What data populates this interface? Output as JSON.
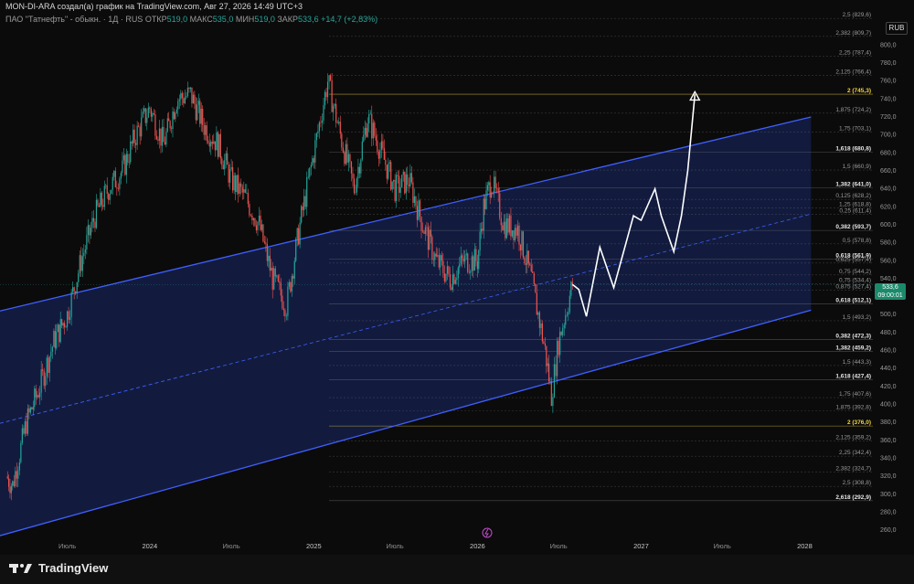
{
  "header": {
    "attribution": "MON-DI-ARA создал(а) график на TradingView.com, Авг 27, 2026 14:49 UTC+3",
    "symbol": "ПАО \"Татнефть\" - обыкн. · 1Д · RUS",
    "open_label": "ОТКР",
    "open_value": "519,0",
    "high_label": "МАКС",
    "high_value": "535,0",
    "low_label": "МИН",
    "low_value": "519,0",
    "close_label": "ЗАКР",
    "close_value": "533,6",
    "change": "+14,7 (+2,83%)"
  },
  "currency": "RUB",
  "price_tag": {
    "price": "533,6",
    "countdown": "09:00:01"
  },
  "brand": "TradingView",
  "colors": {
    "channel": "#3f5fff",
    "fill": "#1a2a6a",
    "up": "#26a69a",
    "down": "#ef5350",
    "projection": "#ffffff"
  },
  "chart_data": {
    "type": "candlestick",
    "y_axis": {
      "range": [
        250,
        840
      ],
      "ticks": [
        260,
        280,
        300,
        320,
        340,
        360,
        380,
        400,
        420,
        440,
        460,
        480,
        500,
        520,
        540,
        560,
        580,
        600,
        620,
        640,
        660,
        680,
        700,
        720,
        740,
        760,
        780,
        800
      ]
    },
    "x_axis": {
      "range": [
        "2023-02-01",
        "2028-06-01"
      ],
      "labels": [
        {
          "t": "2023-07-01",
          "text": "Июль"
        },
        {
          "t": "2024-01-01",
          "text": "2024"
        },
        {
          "t": "2024-07-01",
          "text": "Июль"
        },
        {
          "t": "2025-01-01",
          "text": "2025"
        },
        {
          "t": "2025-07-01",
          "text": "Июль"
        },
        {
          "t": "2026-01-01",
          "text": "2026"
        },
        {
          "t": "2026-07-01",
          "text": "Июль"
        },
        {
          "t": "2027-01-01",
          "text": "2027"
        },
        {
          "t": "2027-07-01",
          "text": "Июль"
        },
        {
          "t": "2028-01-01",
          "text": "2028"
        }
      ]
    },
    "price_path": [
      [
        "2023-02-15",
        320
      ],
      [
        "2023-03-01",
        310
      ],
      [
        "2023-04-01",
        380
      ],
      [
        "2023-05-01",
        420
      ],
      [
        "2023-06-01",
        470
      ],
      [
        "2023-07-01",
        500
      ],
      [
        "2023-08-01",
        560
      ],
      [
        "2023-09-01",
        610
      ],
      [
        "2023-10-01",
        640
      ],
      [
        "2023-11-01",
        660
      ],
      [
        "2023-12-01",
        700
      ],
      [
        "2024-01-01",
        730
      ],
      [
        "2024-02-01",
        690
      ],
      [
        "2024-03-01",
        740
      ],
      [
        "2024-04-01",
        745
      ],
      [
        "2024-05-01",
        710
      ],
      [
        "2024-06-01",
        690
      ],
      [
        "2024-07-01",
        650
      ],
      [
        "2024-08-01",
        630
      ],
      [
        "2024-09-01",
        600
      ],
      [
        "2024-10-01",
        540
      ],
      [
        "2024-11-01",
        510
      ],
      [
        "2024-12-01",
        600
      ],
      [
        "2025-01-01",
        680
      ],
      [
        "2025-02-01",
        760
      ],
      [
        "2025-03-01",
        700
      ],
      [
        "2025-04-01",
        640
      ],
      [
        "2025-05-01",
        720
      ],
      [
        "2025-06-01",
        680
      ],
      [
        "2025-07-01",
        640
      ],
      [
        "2025-08-01",
        650
      ],
      [
        "2025-09-01",
        600
      ],
      [
        "2025-10-01",
        560
      ],
      [
        "2025-11-01",
        540
      ],
      [
        "2025-12-01",
        560
      ],
      [
        "2026-01-01",
        560
      ],
      [
        "2026-01-15",
        620
      ],
      [
        "2026-02-01",
        650
      ],
      [
        "2026-03-01",
        600
      ],
      [
        "2026-04-01",
        595
      ],
      [
        "2026-05-01",
        540
      ],
      [
        "2026-06-01",
        460
      ],
      [
        "2026-06-15",
        410
      ],
      [
        "2026-07-01",
        470
      ],
      [
        "2026-08-01",
        533.6
      ]
    ],
    "projection": [
      [
        "2026-08-15",
        528
      ],
      [
        "2026-09-01",
        498
      ],
      [
        "2026-10-01",
        575
      ],
      [
        "2026-11-01",
        530
      ],
      [
        "2026-12-15",
        610
      ],
      [
        "2027-01-01",
        605
      ],
      [
        "2027-02-01",
        640
      ],
      [
        "2027-02-15",
        610
      ],
      [
        "2027-03-15",
        570
      ],
      [
        "2027-04-01",
        610
      ],
      [
        "2027-04-15",
        660
      ],
      [
        "2027-05-01",
        745
      ]
    ],
    "channel": {
      "upper": [
        [
          "2023-02-01",
          504
        ],
        [
          "2028-01-15",
          720
        ]
      ],
      "lower": [
        [
          "2023-02-01",
          254
        ],
        [
          "2028-01-15",
          505
        ]
      ],
      "mid": [
        [
          "2023-02-01",
          379
        ],
        [
          "2028-01-15",
          612
        ]
      ]
    },
    "fib_levels": [
      {
        "text": "2,5 (829,6)",
        "y": 829.6,
        "bold": false
      },
      {
        "text": "2,382 (809,7)",
        "y": 809.7,
        "bold": false
      },
      {
        "text": "2,25 (787,4)",
        "y": 787.4,
        "bold": false
      },
      {
        "text": "2,125 (766,4)",
        "y": 766.4,
        "bold": false
      },
      {
        "text": "2 (745,3)",
        "y": 745.3,
        "bold": true,
        "color": "#f5d442"
      },
      {
        "text": "1,875 (724,2)",
        "y": 724.2,
        "bold": false
      },
      {
        "text": "1,75 (703,1)",
        "y": 703.1,
        "bold": false
      },
      {
        "text": "1,618 (680,8)",
        "y": 680.8,
        "bold": true
      },
      {
        "text": "1,5 (660,9)",
        "y": 660.9,
        "bold": false
      },
      {
        "text": "1,382 (641,0)",
        "y": 641.0,
        "bold": true
      },
      {
        "text": "0,125 (628,2)",
        "y": 628.2,
        "bold": false
      },
      {
        "text": "1,25 (618,8)",
        "y": 618.8,
        "bold": false
      },
      {
        "text": "0,25 (611,4)",
        "y": 611.4,
        "bold": false
      },
      {
        "text": "0,382 (593,7)",
        "y": 593.7,
        "bold": true
      },
      {
        "text": "0,5 (578,8)",
        "y": 578.8,
        "bold": false
      },
      {
        "text": "0,618 (561,9)",
        "y": 561.9,
        "bold": true
      },
      {
        "text": "0,625 (557,4)",
        "y": 557.4,
        "bold": false
      },
      {
        "text": "0,75 (544,2)",
        "y": 544.2,
        "bold": false
      },
      {
        "text": "0,75 (534,4)",
        "y": 534.4,
        "bold": false
      },
      {
        "text": "0,875 (527,4)",
        "y": 527.4,
        "bold": false
      },
      {
        "text": "0,618 (512,1)",
        "y": 512.1,
        "bold": true
      },
      {
        "text": "1,5 (493,2)",
        "y": 493.2,
        "bold": false
      },
      {
        "text": "0,382 (472,3)",
        "y": 472.3,
        "bold": true
      },
      {
        "text": "1,382 (459,2)",
        "y": 459.2,
        "bold": true
      },
      {
        "text": "1,5 (443,3)",
        "y": 443.3,
        "bold": false
      },
      {
        "text": "1,618 (427,4)",
        "y": 427.4,
        "bold": true
      },
      {
        "text": "1,75 (407,6)",
        "y": 407.6,
        "bold": false
      },
      {
        "text": "1,875 (392,8)",
        "y": 392.8,
        "bold": false
      },
      {
        "text": "2 (376,0)",
        "y": 376.0,
        "bold": true,
        "color": "#f5d442"
      },
      {
        "text": "2,125 (359,2)",
        "y": 359.2,
        "bold": false
      },
      {
        "text": "2,25 (342,4)",
        "y": 342.4,
        "bold": false
      },
      {
        "text": "2,382 (324,7)",
        "y": 324.7,
        "bold": false
      },
      {
        "text": "2,5 (308,8)",
        "y": 308.8,
        "bold": false
      },
      {
        "text": "2,618 (292,9)",
        "y": 292.9,
        "bold": true
      }
    ]
  }
}
